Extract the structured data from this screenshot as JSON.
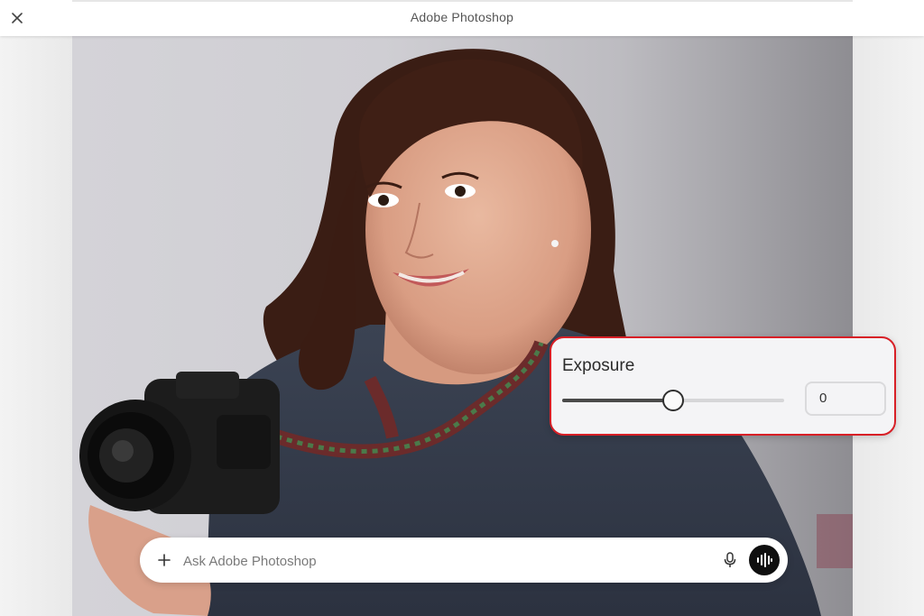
{
  "window": {
    "title": "Adobe Photoshop",
    "close_icon": "close-icon"
  },
  "exposure": {
    "label": "Exposure",
    "value": "0",
    "slider_fraction": 0.5
  },
  "chat": {
    "placeholder": "Ask Adobe Photoshop",
    "add_icon": "plus-icon",
    "mic_icon": "microphone-icon",
    "voice_icon": "voice-waveform-icon"
  },
  "colors": {
    "highlight_border": "#d81f26",
    "voice_button": "#0f0f0f"
  }
}
